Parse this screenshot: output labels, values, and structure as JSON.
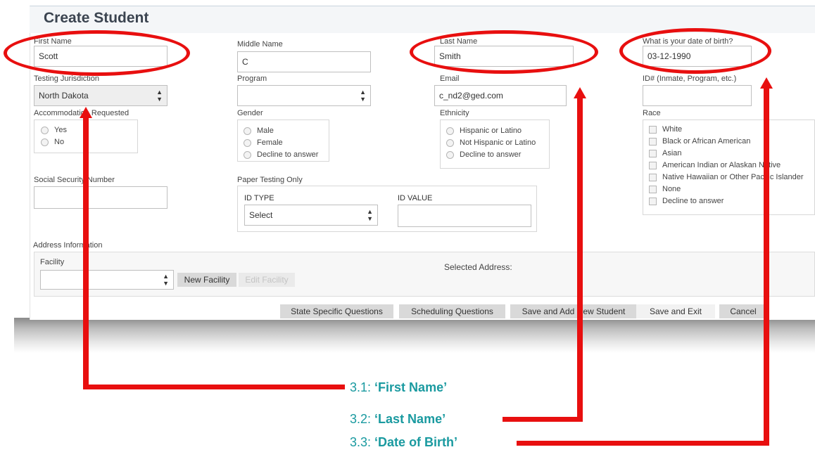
{
  "form": {
    "title": "Create Student",
    "first_name": {
      "label": "First Name",
      "value": "Scott"
    },
    "middle_name": {
      "label": "Middle Name",
      "value": "C"
    },
    "last_name": {
      "label": "Last Name",
      "value": "Smith"
    },
    "dob": {
      "label": "What is your date of birth?",
      "value": "03-12-1990"
    },
    "jurisdiction": {
      "label": "Testing Jurisdiction",
      "value": "North Dakota"
    },
    "program": {
      "label": "Program",
      "value": ""
    },
    "email": {
      "label": "Email",
      "value": "c_nd2@ged.com"
    },
    "id_number": {
      "label": "ID# (Inmate, Program, etc.)",
      "value": ""
    },
    "accommodation": {
      "label": "Accommodation Requested",
      "options": [
        "Yes",
        "No"
      ]
    },
    "gender": {
      "label": "Gender",
      "options": [
        "Male",
        "Female",
        "Decline to answer"
      ]
    },
    "ethnicity": {
      "label": "Ethnicity",
      "options": [
        "Hispanic or Latino",
        "Not Hispanic or Latino",
        "Decline to answer"
      ]
    },
    "race": {
      "label": "Race",
      "options": [
        "White",
        "Black or African American",
        "Asian",
        "American Indian or Alaskan Native",
        "Native Hawaiian or Other Pacific Islander",
        "None",
        "Decline to answer"
      ]
    },
    "ssn": {
      "label": "Social Security Number",
      "value": ""
    },
    "paper_testing": {
      "label": "Paper Testing Only",
      "id_type_label": "ID TYPE",
      "id_type_value": "Select",
      "id_value_label": "ID VALUE"
    },
    "address": {
      "label": "Address Information",
      "facility_label": "Facility",
      "new_facility": "New Facility",
      "edit_facility": "Edit Facility",
      "selected_address": "Selected Address:"
    }
  },
  "buttons": {
    "state_specific": "State Specific Questions",
    "scheduling": "Scheduling Questions",
    "save_add": "Save and Add New Student",
    "save_exit": "Save and Exit",
    "cancel": "Cancel"
  },
  "annotations": {
    "color": "#e80f0f",
    "caption_color": "#1a9aa0",
    "items": [
      {
        "num": "3.1:",
        "text": "‘First Name’"
      },
      {
        "num": "3.2:",
        "text": "‘Last Name’"
      },
      {
        "num": "3.3:",
        "text": "‘Date of Birth’"
      }
    ]
  }
}
